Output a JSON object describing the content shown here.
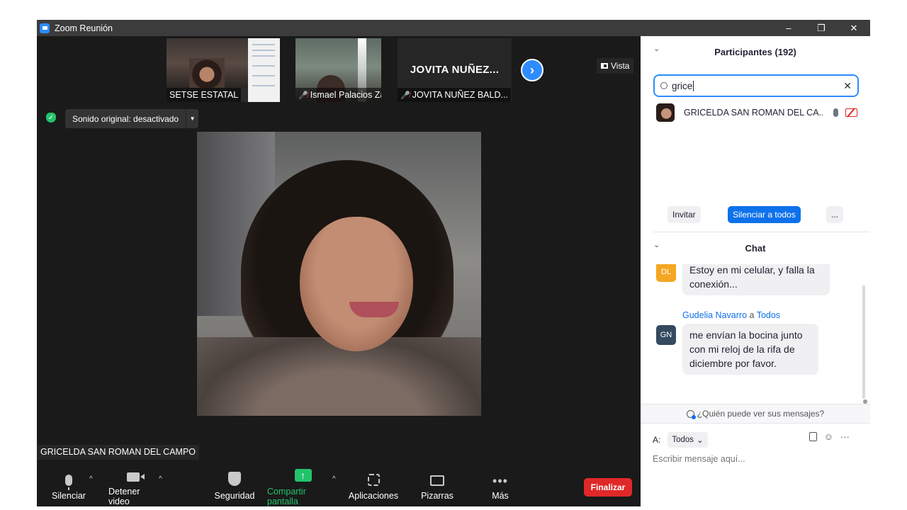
{
  "window": {
    "title": "Zoom Reunión",
    "controls": [
      "–",
      "❐",
      "✕"
    ]
  },
  "thumbnails": [
    {
      "name": "SETSE ESTATAL",
      "muted": false
    },
    {
      "name": "Ismael Palacios Zamo...",
      "muted": true
    },
    {
      "name": "JOVITA NUÑEZ BALD...",
      "muted": true,
      "display_name": "JOVITA NUÑEZ..."
    }
  ],
  "next_arrow": "›",
  "view_label": "Vista",
  "sound_pill": {
    "label": "Sonido original: desactivado",
    "caret": "▼"
  },
  "active_speaker": "GRICELDA SAN ROMAN DEL CAMPO",
  "toolbar": {
    "mute": "Silenciar",
    "stop_video": "Detener video",
    "security": "Seguridad",
    "share": "Compartir pantalla",
    "share_arrow": "↑",
    "apps": "Aplicaciones",
    "whiteboards": "Pizarras",
    "more": "Más",
    "more_dots": "•••",
    "caret": "^",
    "end": "Finalizar"
  },
  "colors": {
    "accent_blue": "#0e71eb",
    "share_green": "#23c36b",
    "end_red": "#e02828"
  },
  "participants": {
    "header": "Participantes (192)",
    "search_value": "grice",
    "clear": "✕",
    "results": [
      {
        "name": "GRICELDA SAN ROMAN DEL CA..."
      }
    ],
    "buttons": {
      "invite": "Invitar",
      "mute_all": "Silenciar a todos",
      "more": "..."
    }
  },
  "chat": {
    "header": "Chat",
    "collapse": "⌄",
    "messages": [
      {
        "initials": "DL",
        "avatar_color": "#f5a623",
        "sender": "",
        "to": "",
        "text": "Estoy en mi celular, y falla la conexión..."
      },
      {
        "initials": "GN",
        "avatar_color": "#344a5e",
        "sender": "Gudelia Navarro",
        "to_word": "a",
        "to": "Todos",
        "text": "me envían la bocina junto con mi reloj de la rifa de diciembre por favor."
      }
    ],
    "visibility_link": "¿Quién puede ver sus mensajes?",
    "to_label": "A:",
    "to_value": "Todos",
    "to_caret": "⌄",
    "emoji": "☺",
    "more": "···",
    "input_placeholder": "Escribir mensaje aquí..."
  }
}
